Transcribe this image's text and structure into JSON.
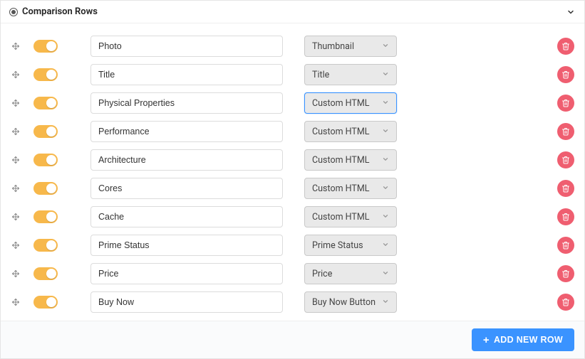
{
  "header": {
    "title": "Comparison Rows"
  },
  "rows": [
    {
      "name": "Photo",
      "type": "Thumbnail",
      "focused": false
    },
    {
      "name": "Title",
      "type": "Title",
      "focused": false
    },
    {
      "name": "Physical Properties",
      "type": "Custom HTML",
      "focused": true
    },
    {
      "name": "Performance",
      "type": "Custom HTML",
      "focused": false
    },
    {
      "name": "Architecture",
      "type": "Custom HTML",
      "focused": false
    },
    {
      "name": "Cores",
      "type": "Custom HTML",
      "focused": false
    },
    {
      "name": "Cache",
      "type": "Custom HTML",
      "focused": false
    },
    {
      "name": "Prime Status",
      "type": "Prime Status",
      "focused": false
    },
    {
      "name": "Price",
      "type": "Price",
      "focused": false
    },
    {
      "name": "Buy Now",
      "type": "Buy Now Button",
      "focused": false
    }
  ],
  "footer": {
    "add_label": "ADD NEW ROW"
  }
}
